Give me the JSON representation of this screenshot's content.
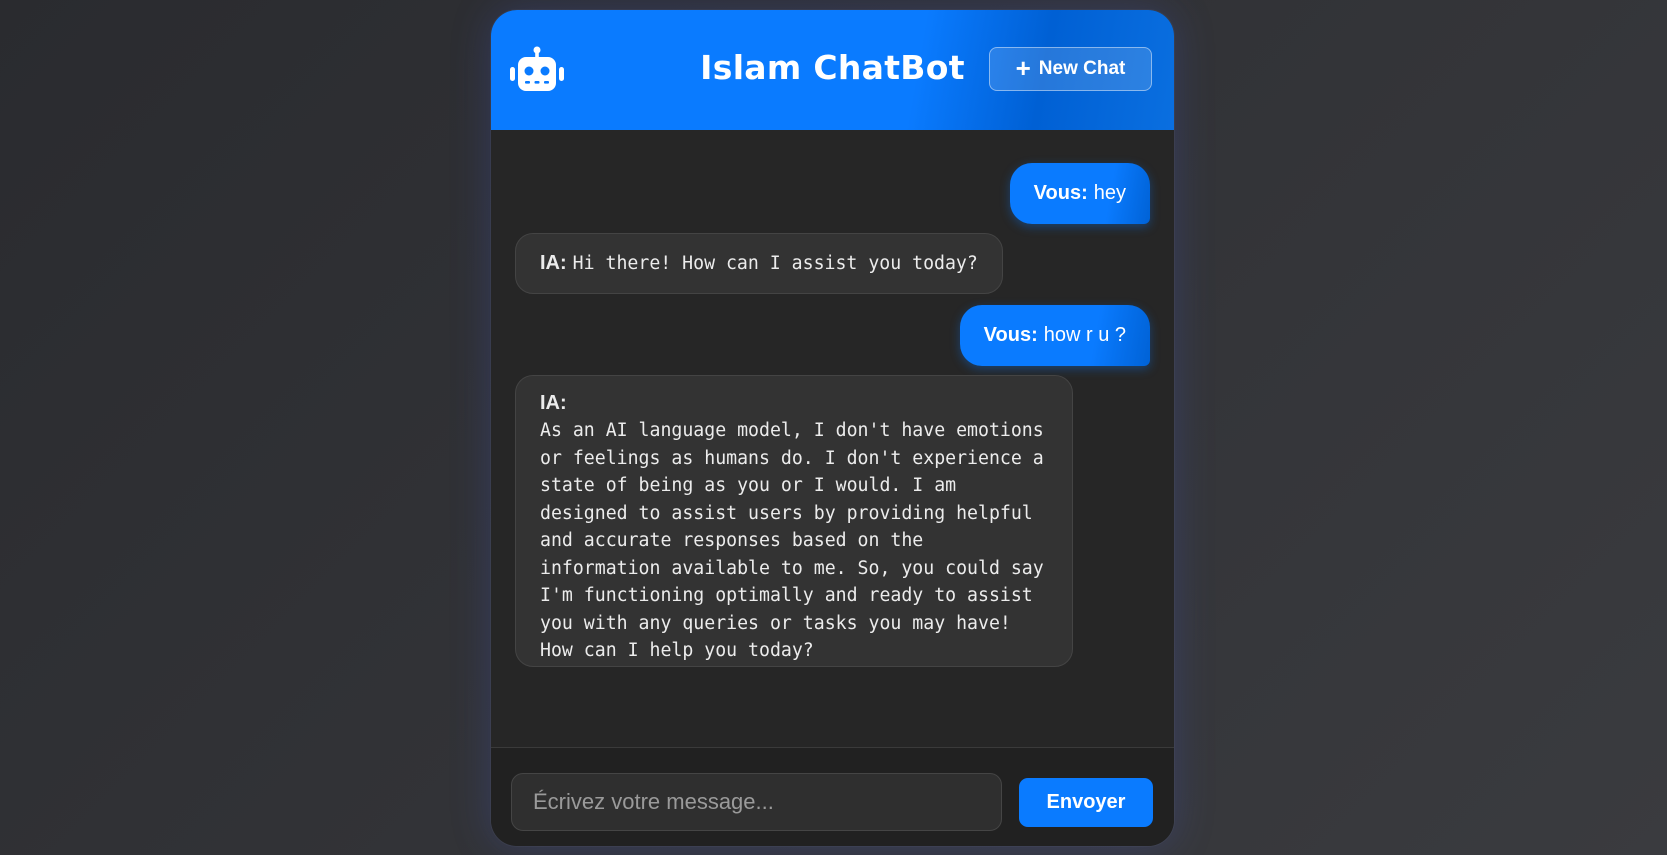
{
  "header": {
    "title": "Islam ChatBot",
    "icon": "robot-icon",
    "new_chat_label": "New Chat",
    "new_chat_icon": "plus-icon"
  },
  "colors": {
    "accent": "#0a7bff",
    "panel_bg": "#262626",
    "ai_bubble_bg": "#333333",
    "page_bg": "#2e2f33"
  },
  "messages": [
    {
      "role": "user",
      "label": "Vous:",
      "text": "hey"
    },
    {
      "role": "ai",
      "label": "IA:",
      "text": "Hi there! How can I assist you today?"
    },
    {
      "role": "user",
      "label": "Vous:",
      "text": "how r u ?"
    },
    {
      "role": "ai",
      "label": "IA:",
      "text": "As an AI language model, I don't have emotions\nor feelings as humans do. I don't experience a\nstate of being as you or I would. I am\ndesigned to assist users by providing helpful\nand accurate responses based on the\ninformation available to me. So, you could say\nI'm functioning optimally and ready to assist\nyou with any queries or tasks you may have!\nHow can I help you today?"
    }
  ],
  "composer": {
    "placeholder": "Écrivez votre message...",
    "value": "",
    "send_label": "Envoyer"
  }
}
